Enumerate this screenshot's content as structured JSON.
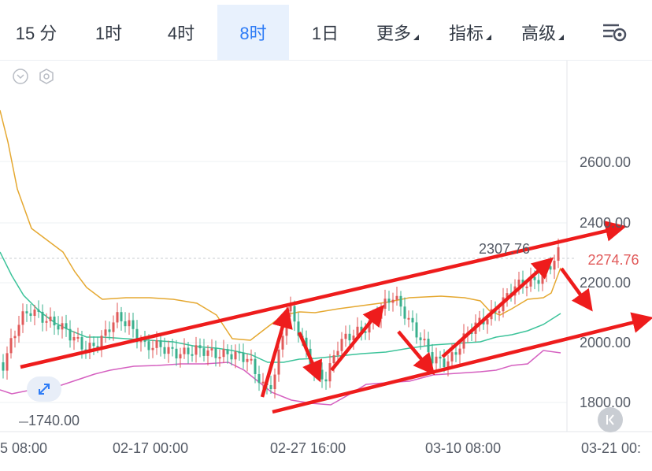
{
  "tabs": [
    {
      "label": "15 分",
      "active": false
    },
    {
      "label": "1时",
      "active": false
    },
    {
      "label": "4时",
      "active": false
    },
    {
      "label": "8时",
      "active": true
    },
    {
      "label": "1日",
      "active": false
    },
    {
      "label": "更多",
      "active": false,
      "dropdown": true
    },
    {
      "label": "指标",
      "active": false,
      "dropdown": true
    },
    {
      "label": "高级",
      "active": false,
      "dropdown": true
    }
  ],
  "icons": {
    "settings": "chart-settings-icon",
    "collapse": "chevron-down-icon",
    "indicator_settings": "hexagon-settings-icon",
    "expand": "expand-arrows-icon",
    "back_latest": "double-chevron-left-icon"
  },
  "chart": {
    "y_axis": [
      "2600.00",
      "2400.00",
      "2200.00",
      "2000.00",
      "1800.00"
    ],
    "x_axis": [
      "5 08:00",
      "02-17 00:00",
      "02-27 16:00",
      "03-10 08:00",
      "03-21 00:"
    ],
    "last_price": "2274.76",
    "max_label": "2307.76",
    "min_label": "1740.00"
  },
  "colors": {
    "accent": "#2e7cf6",
    "up": "#e15a5a",
    "down": "#3ab08e",
    "upper_band": "#e5a830",
    "mid_band": "#3cc39a",
    "lower_band": "#d560c0",
    "arrow": "#ee1c1c"
  }
}
